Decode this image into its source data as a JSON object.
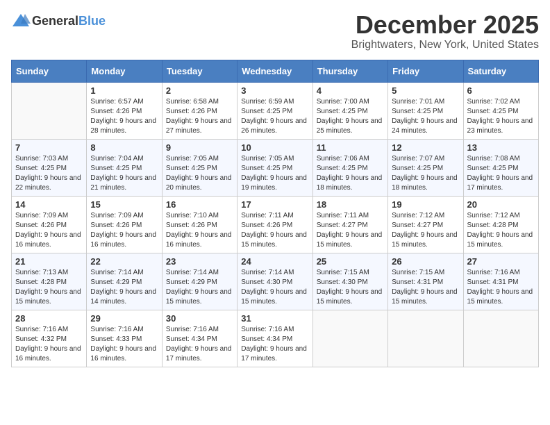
{
  "header": {
    "logo_general": "General",
    "logo_blue": "Blue",
    "title": "December 2025",
    "subtitle": "Brightwaters, New York, United States"
  },
  "weekdays": [
    "Sunday",
    "Monday",
    "Tuesday",
    "Wednesday",
    "Thursday",
    "Friday",
    "Saturday"
  ],
  "weeks": [
    [
      {
        "day": "",
        "sunrise": "",
        "sunset": "",
        "daylight": ""
      },
      {
        "day": "1",
        "sunrise": "Sunrise: 6:57 AM",
        "sunset": "Sunset: 4:26 PM",
        "daylight": "Daylight: 9 hours and 28 minutes."
      },
      {
        "day": "2",
        "sunrise": "Sunrise: 6:58 AM",
        "sunset": "Sunset: 4:26 PM",
        "daylight": "Daylight: 9 hours and 27 minutes."
      },
      {
        "day": "3",
        "sunrise": "Sunrise: 6:59 AM",
        "sunset": "Sunset: 4:25 PM",
        "daylight": "Daylight: 9 hours and 26 minutes."
      },
      {
        "day": "4",
        "sunrise": "Sunrise: 7:00 AM",
        "sunset": "Sunset: 4:25 PM",
        "daylight": "Daylight: 9 hours and 25 minutes."
      },
      {
        "day": "5",
        "sunrise": "Sunrise: 7:01 AM",
        "sunset": "Sunset: 4:25 PM",
        "daylight": "Daylight: 9 hours and 24 minutes."
      },
      {
        "day": "6",
        "sunrise": "Sunrise: 7:02 AM",
        "sunset": "Sunset: 4:25 PM",
        "daylight": "Daylight: 9 hours and 23 minutes."
      }
    ],
    [
      {
        "day": "7",
        "sunrise": "Sunrise: 7:03 AM",
        "sunset": "Sunset: 4:25 PM",
        "daylight": "Daylight: 9 hours and 22 minutes."
      },
      {
        "day": "8",
        "sunrise": "Sunrise: 7:04 AM",
        "sunset": "Sunset: 4:25 PM",
        "daylight": "Daylight: 9 hours and 21 minutes."
      },
      {
        "day": "9",
        "sunrise": "Sunrise: 7:05 AM",
        "sunset": "Sunset: 4:25 PM",
        "daylight": "Daylight: 9 hours and 20 minutes."
      },
      {
        "day": "10",
        "sunrise": "Sunrise: 7:05 AM",
        "sunset": "Sunset: 4:25 PM",
        "daylight": "Daylight: 9 hours and 19 minutes."
      },
      {
        "day": "11",
        "sunrise": "Sunrise: 7:06 AM",
        "sunset": "Sunset: 4:25 PM",
        "daylight": "Daylight: 9 hours and 18 minutes."
      },
      {
        "day": "12",
        "sunrise": "Sunrise: 7:07 AM",
        "sunset": "Sunset: 4:25 PM",
        "daylight": "Daylight: 9 hours and 18 minutes."
      },
      {
        "day": "13",
        "sunrise": "Sunrise: 7:08 AM",
        "sunset": "Sunset: 4:25 PM",
        "daylight": "Daylight: 9 hours and 17 minutes."
      }
    ],
    [
      {
        "day": "14",
        "sunrise": "Sunrise: 7:09 AM",
        "sunset": "Sunset: 4:26 PM",
        "daylight": "Daylight: 9 hours and 16 minutes."
      },
      {
        "day": "15",
        "sunrise": "Sunrise: 7:09 AM",
        "sunset": "Sunset: 4:26 PM",
        "daylight": "Daylight: 9 hours and 16 minutes."
      },
      {
        "day": "16",
        "sunrise": "Sunrise: 7:10 AM",
        "sunset": "Sunset: 4:26 PM",
        "daylight": "Daylight: 9 hours and 16 minutes."
      },
      {
        "day": "17",
        "sunrise": "Sunrise: 7:11 AM",
        "sunset": "Sunset: 4:26 PM",
        "daylight": "Daylight: 9 hours and 15 minutes."
      },
      {
        "day": "18",
        "sunrise": "Sunrise: 7:11 AM",
        "sunset": "Sunset: 4:27 PM",
        "daylight": "Daylight: 9 hours and 15 minutes."
      },
      {
        "day": "19",
        "sunrise": "Sunrise: 7:12 AM",
        "sunset": "Sunset: 4:27 PM",
        "daylight": "Daylight: 9 hours and 15 minutes."
      },
      {
        "day": "20",
        "sunrise": "Sunrise: 7:12 AM",
        "sunset": "Sunset: 4:28 PM",
        "daylight": "Daylight: 9 hours and 15 minutes."
      }
    ],
    [
      {
        "day": "21",
        "sunrise": "Sunrise: 7:13 AM",
        "sunset": "Sunset: 4:28 PM",
        "daylight": "Daylight: 9 hours and 15 minutes."
      },
      {
        "day": "22",
        "sunrise": "Sunrise: 7:14 AM",
        "sunset": "Sunset: 4:29 PM",
        "daylight": "Daylight: 9 hours and 14 minutes."
      },
      {
        "day": "23",
        "sunrise": "Sunrise: 7:14 AM",
        "sunset": "Sunset: 4:29 PM",
        "daylight": "Daylight: 9 hours and 15 minutes."
      },
      {
        "day": "24",
        "sunrise": "Sunrise: 7:14 AM",
        "sunset": "Sunset: 4:30 PM",
        "daylight": "Daylight: 9 hours and 15 minutes."
      },
      {
        "day": "25",
        "sunrise": "Sunrise: 7:15 AM",
        "sunset": "Sunset: 4:30 PM",
        "daylight": "Daylight: 9 hours and 15 minutes."
      },
      {
        "day": "26",
        "sunrise": "Sunrise: 7:15 AM",
        "sunset": "Sunset: 4:31 PM",
        "daylight": "Daylight: 9 hours and 15 minutes."
      },
      {
        "day": "27",
        "sunrise": "Sunrise: 7:16 AM",
        "sunset": "Sunset: 4:31 PM",
        "daylight": "Daylight: 9 hours and 15 minutes."
      }
    ],
    [
      {
        "day": "28",
        "sunrise": "Sunrise: 7:16 AM",
        "sunset": "Sunset: 4:32 PM",
        "daylight": "Daylight: 9 hours and 16 minutes."
      },
      {
        "day": "29",
        "sunrise": "Sunrise: 7:16 AM",
        "sunset": "Sunset: 4:33 PM",
        "daylight": "Daylight: 9 hours and 16 minutes."
      },
      {
        "day": "30",
        "sunrise": "Sunrise: 7:16 AM",
        "sunset": "Sunset: 4:34 PM",
        "daylight": "Daylight: 9 hours and 17 minutes."
      },
      {
        "day": "31",
        "sunrise": "Sunrise: 7:16 AM",
        "sunset": "Sunset: 4:34 PM",
        "daylight": "Daylight: 9 hours and 17 minutes."
      },
      {
        "day": "",
        "sunrise": "",
        "sunset": "",
        "daylight": ""
      },
      {
        "day": "",
        "sunrise": "",
        "sunset": "",
        "daylight": ""
      },
      {
        "day": "",
        "sunrise": "",
        "sunset": "",
        "daylight": ""
      }
    ]
  ]
}
